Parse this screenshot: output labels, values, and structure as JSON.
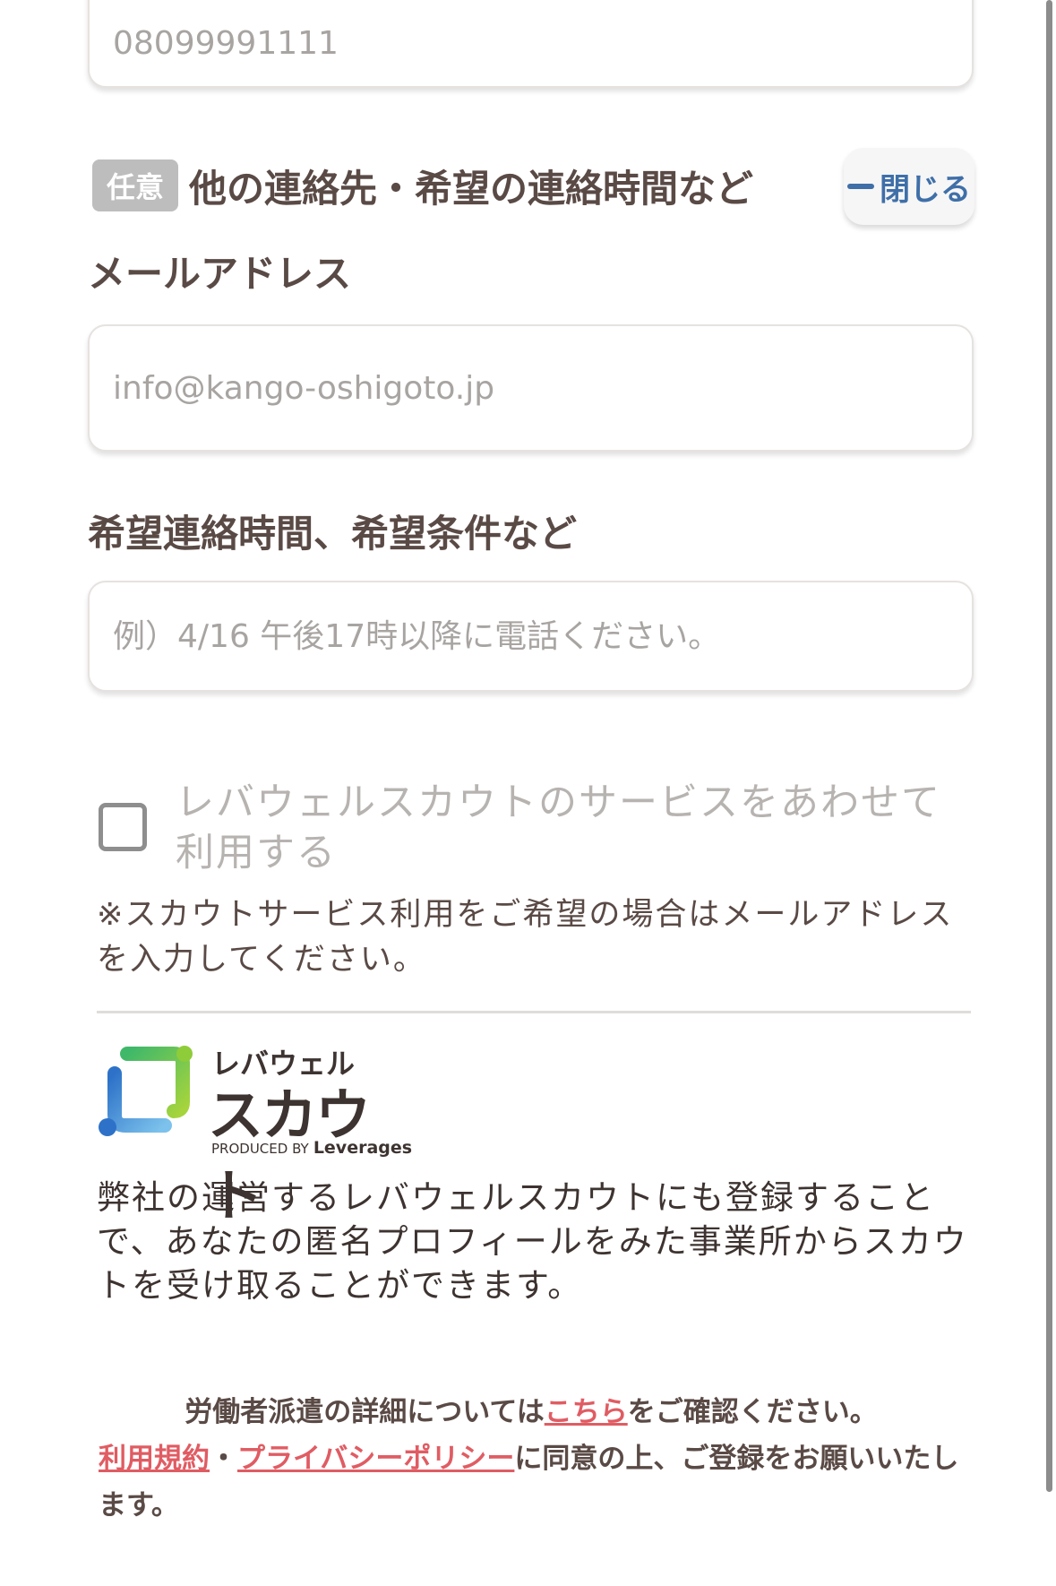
{
  "phone": {
    "placeholder": "08099991111"
  },
  "other_contact": {
    "badge": "任意",
    "title": "他の連絡先・希望の連絡時間など",
    "close_label": "閉じる"
  },
  "email": {
    "label": "メールアドレス",
    "placeholder": "info@kango-oshigoto.jp"
  },
  "contact_time": {
    "label": "希望連絡時間、希望条件など",
    "placeholder": "例）4/16 午後17時以降に電話ください。"
  },
  "scout": {
    "checkbox_label": "レバウェルスカウトのサービスをあわせて利用する",
    "checked": false,
    "note": "※スカウトサービス利用をご希望の場合はメールアドレスを入力してください。",
    "logo_top": "レバウェル",
    "logo_main": "スカウト",
    "logo_produced": "PRODUCED BY",
    "logo_brand": "Leverages",
    "description": "弊社の運営するレバウェルスカウトにも登録することで、あなたの匿名プロフィールをみた事業所からスカウトを受け取ることができます。"
  },
  "footer": {
    "line1_pre": "労働者派遣の詳細については",
    "line1_link": "こちら",
    "line1_post": "をご確認ください。",
    "terms_link": "利用規約",
    "separator": "・",
    "privacy_link": "プライバシーポリシー",
    "line2_post": "に同意の上、ご登録をお願いいたします。"
  },
  "colors": {
    "text": "#5a4a45",
    "accent_blue": "#3f6fa8",
    "link": "#e05c63",
    "badge_bg": "#bdbdbd"
  }
}
